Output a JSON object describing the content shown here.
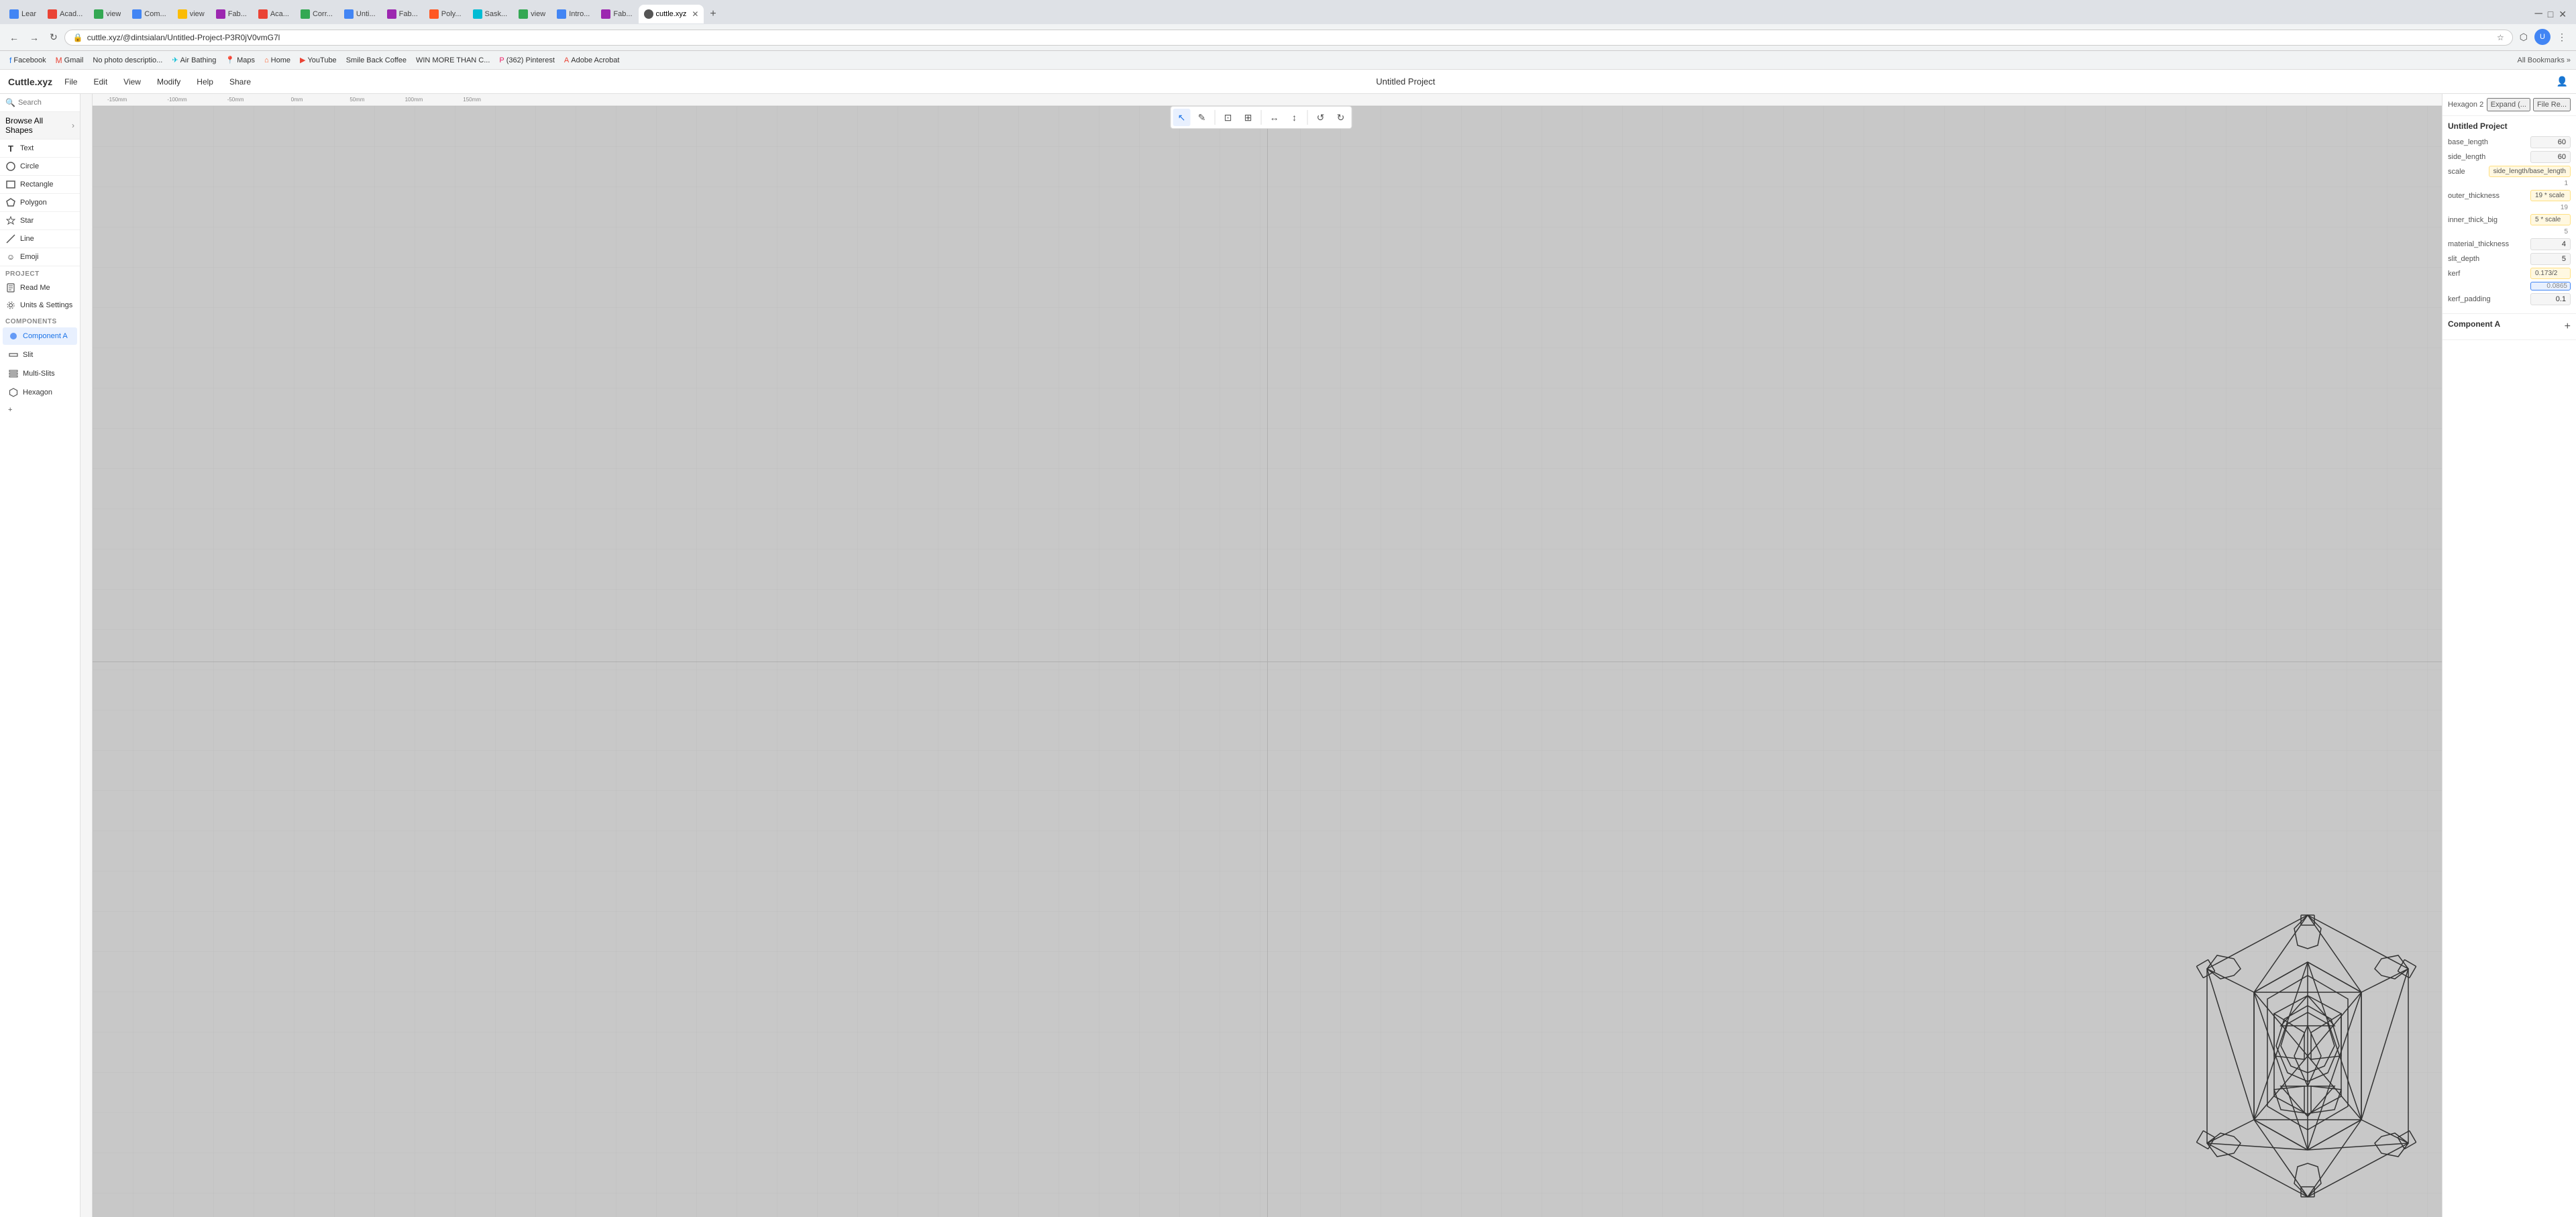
{
  "browser": {
    "tabs": [
      {
        "label": "Learn",
        "favicon_color": "#4285f4",
        "active": false
      },
      {
        "label": "Acad...",
        "favicon_color": "#ea4335",
        "active": false
      },
      {
        "label": "view",
        "favicon_color": "#34a853",
        "active": false
      },
      {
        "label": "Com...",
        "favicon_color": "#4285f4",
        "active": false
      },
      {
        "label": "view",
        "favicon_color": "#fbbc04",
        "active": false
      },
      {
        "label": "Fab...",
        "favicon_color": "#9c27b0",
        "active": false
      },
      {
        "label": "Aca...",
        "favicon_color": "#ea4335",
        "active": false
      },
      {
        "label": "Corr...",
        "favicon_color": "#34a853",
        "active": false
      },
      {
        "label": "Unti...",
        "favicon_color": "#4285f4",
        "active": false
      },
      {
        "label": "Fab...",
        "favicon_color": "#9c27b0",
        "active": false
      },
      {
        "label": "Poly...",
        "favicon_color": "#ff5722",
        "active": false
      },
      {
        "label": "Sask...",
        "favicon_color": "#00bcd4",
        "active": false
      },
      {
        "label": "view",
        "favicon_color": "#34a853",
        "active": false
      },
      {
        "label": "Intro...",
        "favicon_color": "#4285f4",
        "active": false
      },
      {
        "label": "Fab...",
        "favicon_color": "#9c27b0",
        "active": false
      },
      {
        "label": "cuttle.xyz",
        "favicon_color": "#555",
        "active": true
      },
      {
        "label": "x",
        "favicon_color": "#000",
        "active": false
      }
    ],
    "address": "cuttle.xyz/@dintsialan/Untitled-Project-P3R0jV0vmG7l",
    "bookmarks": [
      {
        "label": "Facebook",
        "color": "#1877f2"
      },
      {
        "label": "Gmail",
        "color": "#ea4335"
      },
      {
        "label": "No photo descriptio...",
        "color": "#888"
      },
      {
        "label": "Air Bathing",
        "color": "#00bcd4"
      },
      {
        "label": "Maps",
        "color": "#34a853"
      },
      {
        "label": "Home",
        "color": "#ff5722"
      },
      {
        "label": "YouTube",
        "color": "#ea4335"
      },
      {
        "label": "Smile Back Coffee",
        "color": "#795548"
      },
      {
        "label": "WIN MORE THAN C...",
        "color": "#4285f4"
      },
      {
        "label": "(362) Pinterest",
        "color": "#e91e63"
      },
      {
        "label": "Adobe Acrobat",
        "color": "#ea4335"
      }
    ]
  },
  "app": {
    "logo": "Cuttle.xyz",
    "title": "Untitled Project",
    "menu": [
      "File",
      "Edit",
      "View",
      "Modify",
      "Help",
      "Share"
    ]
  },
  "sidebar": {
    "search_placeholder": "Search",
    "browse_all_label": "Browse All Shapes",
    "shapes": [
      {
        "label": "Text",
        "icon": "T"
      },
      {
        "label": "Circle",
        "icon": "○"
      },
      {
        "label": "Rectangle",
        "icon": "□"
      },
      {
        "label": "Polygon",
        "icon": "⬡"
      },
      {
        "label": "Star",
        "icon": "★"
      },
      {
        "label": "Line",
        "icon": "—"
      },
      {
        "label": "Emoji",
        "icon": "☺"
      }
    ],
    "project_section": "PROJECT",
    "project_items": [
      {
        "label": "Read Me",
        "icon": "doc"
      },
      {
        "label": "Units & Settings",
        "icon": "gear"
      }
    ],
    "components_section": "COMPONENTS",
    "components": [
      {
        "label": "Component A",
        "active": true
      },
      {
        "label": "Slit",
        "active": false
      },
      {
        "label": "Multi-Slits",
        "active": false
      },
      {
        "label": "Hexagon",
        "active": false
      }
    ],
    "add_button": "+"
  },
  "toolbar": {
    "buttons": [
      {
        "icon": "↖",
        "label": "select",
        "active": true
      },
      {
        "icon": "✎",
        "label": "pen",
        "active": false
      },
      {
        "icon": "⊡",
        "label": "transform",
        "active": false
      },
      {
        "icon": "⊞",
        "label": "grid",
        "active": false
      },
      {
        "icon": "↔",
        "label": "flip-h",
        "active": false
      },
      {
        "icon": "↕",
        "label": "flip-v",
        "active": false
      },
      {
        "icon": "↺",
        "label": "undo",
        "active": false
      },
      {
        "icon": "↻",
        "label": "redo",
        "active": false
      }
    ]
  },
  "right_panel": {
    "breadcrumb": "Hexagon 2",
    "expand_label": "Expand (...",
    "filter_label": "File Re...",
    "project_title": "Untitled Project",
    "params": [
      {
        "label": "base_length",
        "value": "60",
        "formula": "",
        "computed": ""
      },
      {
        "label": "side_length",
        "value": "60",
        "formula": "",
        "computed": ""
      },
      {
        "label": "scale",
        "formula": "side_length/base_length",
        "computed": "1"
      },
      {
        "label": "outer_thickness",
        "formula": "19 * scale",
        "computed": "19"
      },
      {
        "label": "inner_thick_big",
        "formula": "5 * scale",
        "computed": "5"
      },
      {
        "label": "material_thickness",
        "value": "4",
        "formula": "",
        "computed": ""
      },
      {
        "label": "slit_depth",
        "value": "5",
        "formula": "",
        "computed": ""
      },
      {
        "label": "kerf",
        "formula": "0.173/2",
        "computed": "0.0865"
      },
      {
        "label": "kerf_padding",
        "value": "0.1",
        "formula": "",
        "computed": ""
      }
    ],
    "component_a_label": "Component A",
    "add_label": "+"
  },
  "canvas": {
    "ruler_labels": [
      "-150mm",
      "-100mm",
      "-50mm",
      "0mm",
      "50mm",
      "100mm",
      "150mm"
    ]
  }
}
